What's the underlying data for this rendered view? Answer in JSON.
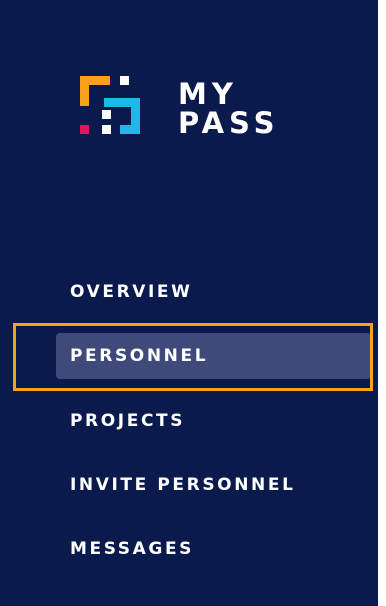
{
  "brand": {
    "line1": "MY",
    "line2": "PASS",
    "trademark": "™",
    "colors": {
      "orange": "#f7a21b",
      "cyan": "#1fb6e8",
      "magenta": "#e8125c",
      "white": "#ffffff"
    }
  },
  "nav": {
    "items": [
      {
        "label": "OVERVIEW",
        "active": false
      },
      {
        "label": "PERSONNEL",
        "active": true
      },
      {
        "label": "PROJECTS",
        "active": false
      },
      {
        "label": "INVITE PERSONNEL",
        "active": false
      },
      {
        "label": "MESSAGES",
        "active": false
      }
    ]
  },
  "theme": {
    "sidebar_bg": "#0b1a4d",
    "active_bg": "#3f4a7a",
    "highlight": "#f7a21b"
  }
}
